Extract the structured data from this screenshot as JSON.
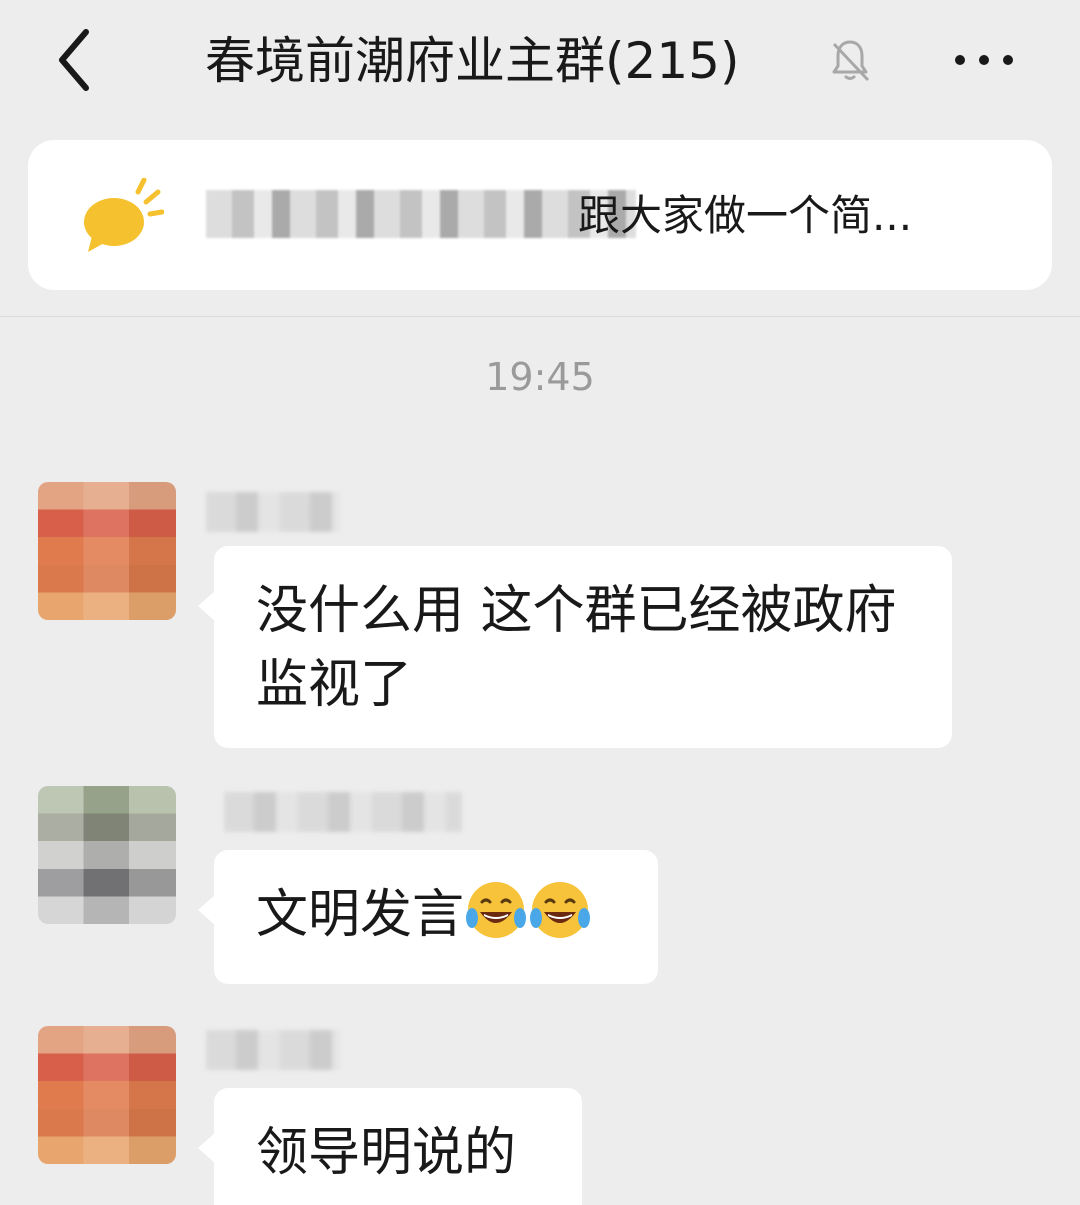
{
  "header": {
    "title": "春境前潮府业主群(215)",
    "back_icon": "chevron-left-icon",
    "mute_icon": "bell-off-icon",
    "more_icon": "ellipsis-icon"
  },
  "pinned": {
    "icon": "chat-bubble-icon",
    "text": "跟大家做一个简..."
  },
  "timestamp": "19:45",
  "messages": [
    {
      "text": "没什么用 这个群已经被政府监视了"
    },
    {
      "text": "文明发言",
      "emoji": "face-with-tears-of-joy-icon"
    },
    {
      "text": "领导明说的"
    }
  ],
  "colors": {
    "background": "#ededed",
    "bubble": "#ffffff",
    "accent_yellow": "#f5c12e"
  }
}
